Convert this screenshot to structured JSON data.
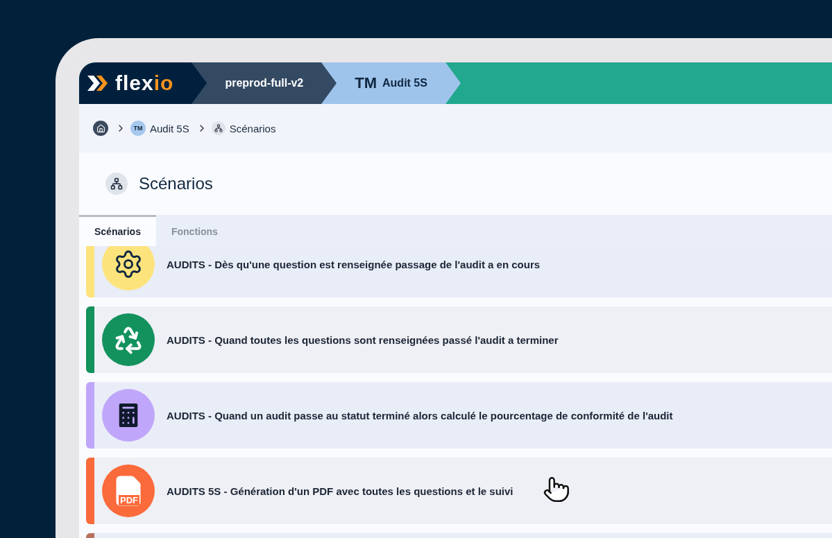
{
  "top_bar": {
    "logo": {
      "text": "flex",
      "accent": "io"
    },
    "segments": [
      {
        "kind": "env",
        "label": "preprod-full-v2"
      },
      {
        "kind": "app",
        "badge": "TM",
        "label": "Audit 5S"
      }
    ]
  },
  "breadcrumb": [
    {
      "kind": "home"
    },
    {
      "kind": "app",
      "badge": "TM",
      "label": "Audit 5S"
    },
    {
      "kind": "page",
      "label": "Scénarios"
    }
  ],
  "page_title": "Scénarios",
  "tabs": [
    {
      "label": "Scénarios",
      "selected": true
    },
    {
      "label": "Fonctions",
      "selected": false
    }
  ],
  "scenarios": [
    {
      "kind": "gear",
      "color": "#fde37c",
      "title": "AUDITS - Dès qu'une question est renseignée passage de l'audit a en cours"
    },
    {
      "kind": "recycle",
      "color": "#13925e",
      "title": "AUDITS - Quand toutes les questions sont renseignées passé l'audit a terminer"
    },
    {
      "kind": "calculator",
      "color": "#c0a6fa",
      "title": "AUDITS - Quand un audit passe au statut terminé alors calculé le pourcentage de conformité de l'audit"
    },
    {
      "kind": "pdf",
      "icon_label": "PDF",
      "color": "#fb6a3b",
      "title": "AUDITS 5S - Génération d'un PDF avec toutes les questions et le suivi"
    },
    {
      "kind": "blank",
      "color": "#b9705c"
    }
  ]
}
